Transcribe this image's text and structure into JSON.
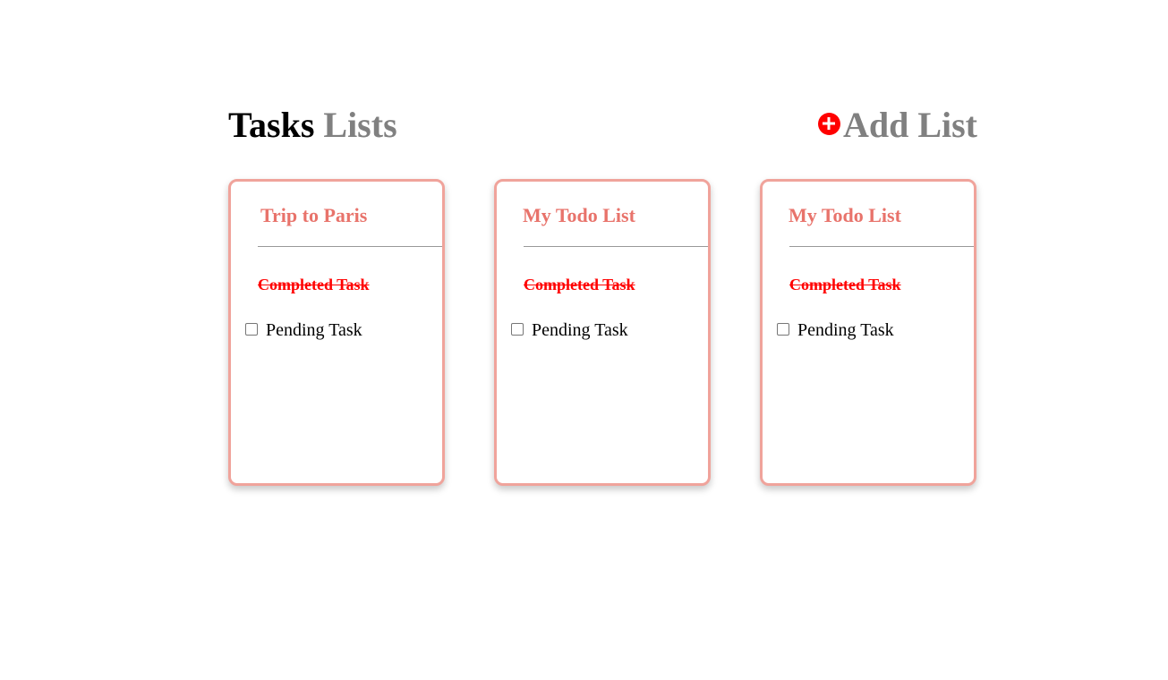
{
  "header": {
    "title_part1": "Tasks",
    "title_part2": "Lists",
    "add_list_label": "Add List",
    "add_icon": "plus-circle-icon"
  },
  "colors": {
    "accent_red": "#ff0000",
    "card_border": "#f0a39b",
    "card_title": "#e8736b",
    "muted_gray": "#808080"
  },
  "lists": [
    {
      "title": "Trip to Paris",
      "completed_task": "Completed Task",
      "pending_task": "Pending Task"
    },
    {
      "title": "My Todo List",
      "completed_task": "Completed Task",
      "pending_task": "Pending Task"
    },
    {
      "title": "My Todo List",
      "completed_task": "Completed Task",
      "pending_task": "Pending Task"
    }
  ]
}
